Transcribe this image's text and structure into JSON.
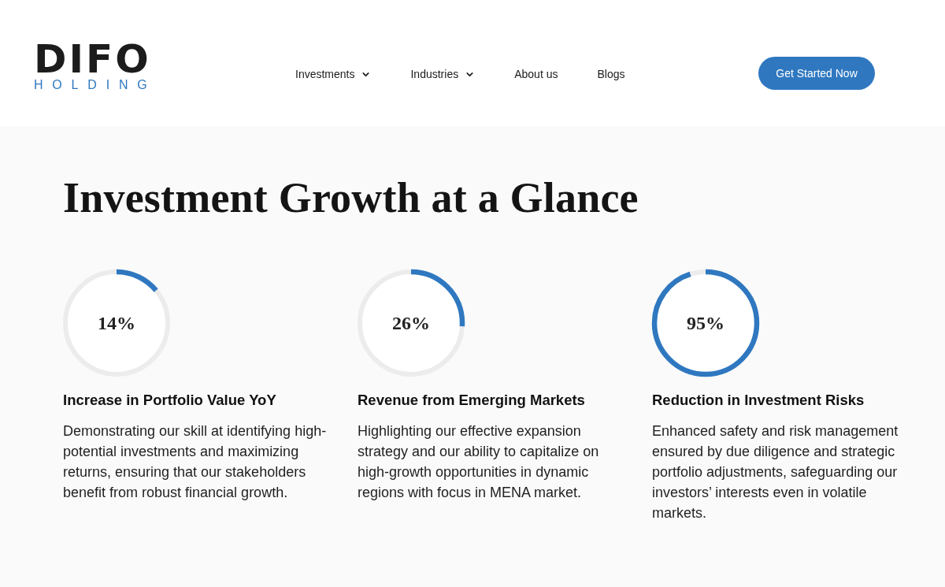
{
  "header": {
    "logo": {
      "wordmark": "DIFO",
      "subtitle": "HOLDING"
    },
    "nav": [
      {
        "label": "Investments",
        "dropdown": true
      },
      {
        "label": "Industries",
        "dropdown": true
      },
      {
        "label": "About us",
        "dropdown": false
      },
      {
        "label": "Blogs",
        "dropdown": false
      }
    ],
    "cta": "Get Started Now"
  },
  "section": {
    "title": "Investment Growth at a Glance",
    "stats": [
      {
        "value": "14%",
        "level": 0.14,
        "heading": "Increase in Portfolio Value YoY",
        "text": "Demonstrating our skill at identifying high-potential investments and maximizing returns, ensuring that our stakeholders benefit from robust financial growth."
      },
      {
        "value": "26%",
        "level": 0.26,
        "heading": "Revenue from Emerging Markets",
        "text": "Highlighting our effective expansion strategy and our ability to capitalize on high-growth opportunities in dynamic regions with focus in MENA market."
      },
      {
        "value": "95%",
        "level": 0.95,
        "heading": "Reduction in Investment Risks",
        "text": "Enhanced safety and risk management ensured by due diligence and strategic portfolio adjustments, safeguarding our investors’ interests even in volatile markets."
      }
    ]
  }
}
